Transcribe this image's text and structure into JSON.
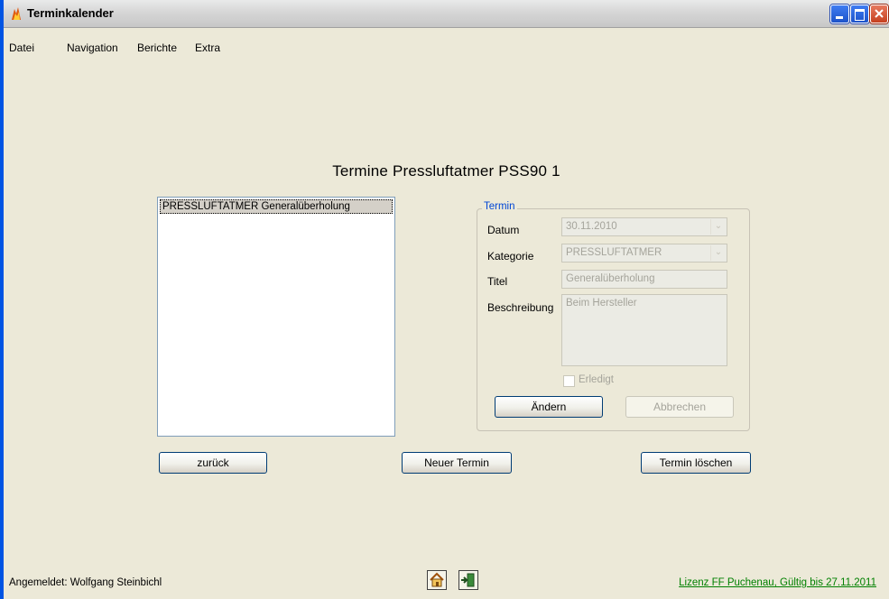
{
  "window": {
    "title": "Terminkalender"
  },
  "menu": {
    "items": [
      "Datei",
      "Navigation",
      "Berichte",
      "Extra"
    ]
  },
  "main": {
    "heading": "Termine Pressluftatmer PSS90 1",
    "list": {
      "items": [
        "PRESSLUFTATMER Generalüberholung"
      ]
    }
  },
  "termin": {
    "legend": "Termin",
    "datum_label": "Datum",
    "datum_value": "30.11.2010",
    "kategorie_label": "Kategorie",
    "kategorie_value": "PRESSLUFTATMER",
    "titel_label": "Titel",
    "titel_value": "Generalüberholung",
    "beschreibung_label": "Beschreibung",
    "beschreibung_value": "Beim Hersteller",
    "erledigt_label": "Erledigt",
    "aendern_label": "Ändern",
    "abbrechen_label": "Abbrechen"
  },
  "actions": {
    "zurueck_label": "zurück",
    "neuer_termin_label": "Neuer Termin",
    "termin_loeschen_label": "Termin löschen"
  },
  "status": {
    "logged_in": "Angemeldet: Wolfgang Steinbichl",
    "license": "Lizenz FF Puchenau, Gültig bis 27.11.2011"
  },
  "icons": {
    "app": "flame-icon",
    "home": "home-icon",
    "exit": "exit-door-icon"
  },
  "colors": {
    "accent": "#0046d5",
    "license": "#008000",
    "window_bg": "#ece9d8"
  }
}
